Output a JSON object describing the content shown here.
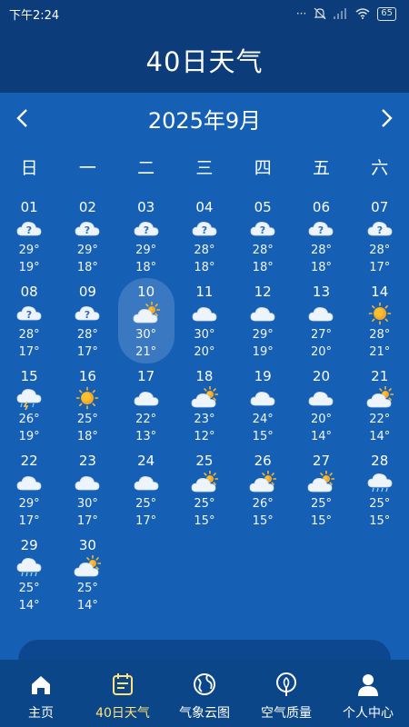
{
  "status_bar": {
    "time": "下午2:24",
    "battery": "65"
  },
  "header": {
    "title": "40日天气"
  },
  "month_nav": {
    "label": "2025年9月",
    "prev_icon": "chevron-left-icon",
    "next_icon": "chevron-right-icon"
  },
  "weekdays": [
    "日",
    "一",
    "二",
    "三",
    "四",
    "五",
    "六"
  ],
  "days": [
    {
      "date": "01",
      "icon": "unknown",
      "high": "29°",
      "low": "19°"
    },
    {
      "date": "02",
      "icon": "unknown",
      "high": "29°",
      "low": "18°"
    },
    {
      "date": "03",
      "icon": "unknown",
      "high": "29°",
      "low": "18°"
    },
    {
      "date": "04",
      "icon": "unknown",
      "high": "28°",
      "low": "18°"
    },
    {
      "date": "05",
      "icon": "unknown",
      "high": "28°",
      "low": "18°"
    },
    {
      "date": "06",
      "icon": "unknown",
      "high": "28°",
      "low": "18°"
    },
    {
      "date": "07",
      "icon": "unknown",
      "high": "28°",
      "low": "17°"
    },
    {
      "date": "08",
      "icon": "unknown",
      "high": "28°",
      "low": "17°"
    },
    {
      "date": "09",
      "icon": "unknown",
      "high": "28°",
      "low": "17°"
    },
    {
      "date": "10",
      "icon": "partly-cloudy",
      "high": "30°",
      "low": "21°",
      "selected": true
    },
    {
      "date": "11",
      "icon": "cloudy",
      "high": "30°",
      "low": "20°"
    },
    {
      "date": "12",
      "icon": "cloudy",
      "high": "29°",
      "low": "19°"
    },
    {
      "date": "13",
      "icon": "cloudy",
      "high": "27°",
      "low": "20°"
    },
    {
      "date": "14",
      "icon": "sunny",
      "high": "28°",
      "low": "21°"
    },
    {
      "date": "15",
      "icon": "thunderstorm",
      "high": "26°",
      "low": "19°"
    },
    {
      "date": "16",
      "icon": "sunny",
      "high": "25°",
      "low": "18°"
    },
    {
      "date": "17",
      "icon": "cloudy",
      "high": "22°",
      "low": "13°"
    },
    {
      "date": "18",
      "icon": "partly-cloudy",
      "high": "23°",
      "low": "12°"
    },
    {
      "date": "19",
      "icon": "cloudy",
      "high": "24°",
      "low": "15°"
    },
    {
      "date": "20",
      "icon": "cloudy",
      "high": "20°",
      "low": "14°"
    },
    {
      "date": "21",
      "icon": "partly-cloudy",
      "high": "22°",
      "low": "14°"
    },
    {
      "date": "22",
      "icon": "cloudy",
      "high": "29°",
      "low": "17°"
    },
    {
      "date": "23",
      "icon": "cloudy",
      "high": "30°",
      "low": "17°"
    },
    {
      "date": "24",
      "icon": "cloudy",
      "high": "25°",
      "low": "17°"
    },
    {
      "date": "25",
      "icon": "partly-cloudy",
      "high": "25°",
      "low": "15°"
    },
    {
      "date": "26",
      "icon": "partly-cloudy",
      "high": "26°",
      "low": "15°"
    },
    {
      "date": "27",
      "icon": "partly-cloudy",
      "high": "25°",
      "low": "15°"
    },
    {
      "date": "28",
      "icon": "rain",
      "high": "25°",
      "low": "15°"
    },
    {
      "date": "29",
      "icon": "rain",
      "high": "25°",
      "low": "14°"
    },
    {
      "date": "30",
      "icon": "partly-cloudy",
      "high": "25°",
      "low": "14°"
    }
  ],
  "tabs": [
    {
      "label": "主页",
      "icon": "home-icon",
      "active": false
    },
    {
      "label": "40日天气",
      "icon": "calendar-icon",
      "active": true
    },
    {
      "label": "气象云图",
      "icon": "globe-icon",
      "active": false
    },
    {
      "label": "空气质量",
      "icon": "leaf-icon",
      "active": false
    },
    {
      "label": "个人中心",
      "icon": "user-icon",
      "active": false
    }
  ],
  "colors": {
    "background": "#1560b5",
    "header": "#0c3d7a",
    "active_tab": "#ffe27a"
  }
}
